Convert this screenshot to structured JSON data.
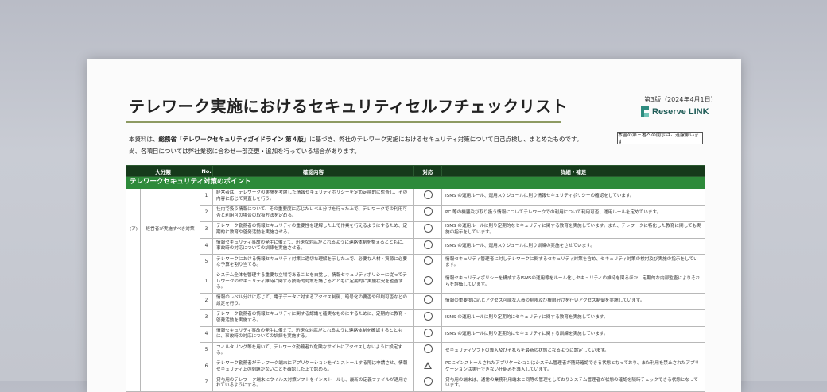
{
  "document": {
    "title": "テレワーク実施におけるセキュリティセルフチェックリスト",
    "edition": "第3版（2024年4月1日）",
    "brand": "Reserve LINK",
    "intro_line1_prefix": "本資料は、",
    "intro_line1_bold": "総務省「テレワークセキュリティガイドライン 第４版」",
    "intro_line1_suffix": "に基づき、弊社のテレワーク実施におけるセキュリティ対策について自己点検し、まとめたものです。",
    "intro_line2": "尚、各項目については弊社業務に合わせ一部変更・追加を行っている場合があります。",
    "notice": "本書の第三者への開示はご遠慮願います"
  },
  "table": {
    "headers": {
      "category": "大分類",
      "no": "No.",
      "content": "確認内容",
      "status": "対応",
      "details": "詳細・補足"
    },
    "section_title": "テレワークセキュリティ対策のポイント",
    "group1": {
      "code": "(ア)",
      "label": "経営者が実施すべき対策",
      "rows": [
        {
          "no": "1",
          "content": "経営者は、テレワークの実施を考慮した情報セキュリティポリシーを定め定期的に監査し、その内容に応じて見直しを行う。",
          "status": "circle",
          "detail": "ISMS の運用ルール、運用スケジュールに則り情報セキュリティポリシーの確認をしています。"
        },
        {
          "no": "2",
          "content": "社内で扱う情報について、その重要度に応じたレベル分けを行った上で、テレワークでの利用可否と利用可の場合の取扱方法を定める。",
          "status": "circle",
          "detail": "PC 等の機器及び取り扱う情報についてテレワークでの利用について利用可否、運用ルールを定めています。"
        },
        {
          "no": "3",
          "content": "テレワーク勤務者の情報セキュリティの重要性を理解した上で作業を行えるようにするため、定期的に教育や啓発活動を実施させる。",
          "status": "circle",
          "detail": "ISMS の運用ルールに則り定期的なセキュリティに関する教育を実施しています。また、テレワークに特化した教育に関しても実施の指示をしています。"
        },
        {
          "no": "4",
          "content": "情報セキュリティ事故の発生に備えて、迅速な対応がとれるように連絡体制を整えるとともに、事故時の対応についての訓練を実施させる。",
          "status": "circle",
          "detail": "ISMS の運用ルール、運用スケジュールに則り訓練の実施をさせています。"
        },
        {
          "no": "5",
          "content": "テレワークにおける情報セキュリティ対策に適切な理解を示した上で、必要な人材・資源に必要な予算を割り当てる。",
          "status": "circle",
          "detail": "情報セキュリティ管理者に対しテレワークに関するセキュリティ対策を含め、セキュリティ対策の検討及び実施の指示をしています。"
        }
      ]
    },
    "group2": {
      "rows": [
        {
          "no": "1",
          "content": "システム全体を管理する重要な立場であることを自覚し、情報セキュリティポリシーに従ってテレワークのセキュリティ維持に関する技術的対策を講じるとともに定期的に実施状況を監査する。",
          "status": "circle",
          "detail": "情報セキュリティポリシーを構成するISMSの運用等をルール化しセキュリティの維持を図るほか、定期的な内部監査によりそれらを評価しています。"
        },
        {
          "no": "2",
          "content": "情報のレベル分けに応じて、電子データに対するアクセス制御、暗号化の要否や印刷可否などの設定を行う。",
          "status": "circle",
          "detail": "情報の重要度に応じアクセス可能な人員の制限及び権限分けを行いアクセス制御を実施しています。"
        },
        {
          "no": "3",
          "content": "テレワーク勤務者の情報セキュリティに関する認識を確実なものにするために、定期的に教育・啓発活動を実施する。",
          "status": "circle",
          "detail": "ISMS の運用ルールに則り定期的にセキュリティに関する教育を実施しています。"
        },
        {
          "no": "4",
          "content": "情報セキュリティ事故の発生に備えて、迅速な対応がとれるように連絡体制を確認するとともに、事故時の対応についての訓練を実施する。",
          "status": "circle",
          "detail": "ISMS の運用ルールに則り定期的にセキュリティに関する訓練を実施しています。"
        },
        {
          "no": "5",
          "content": "フィルタリング等を用いて、テレワーク勤務者が危険なサイトにアクセスしないように設定する。",
          "status": "circle",
          "detail": "セキュリティソフトの導入及びそれらを最新の状態となるように設定しています。"
        },
        {
          "no": "6",
          "content": "テレワーク勤務者がテレワーク端末にアプリケーションをインストールする際は申請させ、情報セキュリティ上の問題がないことを確認した上で認める。",
          "status": "triangle",
          "detail": "PCにインストールされたアプリケーションはシステム管理者が随時確認できる状態となっており、また利用を禁止されたアプリケーションは実行できない仕組みを導入しています。"
        },
        {
          "no": "7",
          "content": "貸与用のテレワーク端末にウイルス対策ソフトをインストールし、最新の定義ファイルが適用されているようにする。",
          "status": "circle",
          "detail": "貸与用の端末は、通常の業務利用端末と同等の管理をしておりシステム管理者が状態の確認を随時チェックできる状態となっています。"
        }
      ]
    }
  }
}
